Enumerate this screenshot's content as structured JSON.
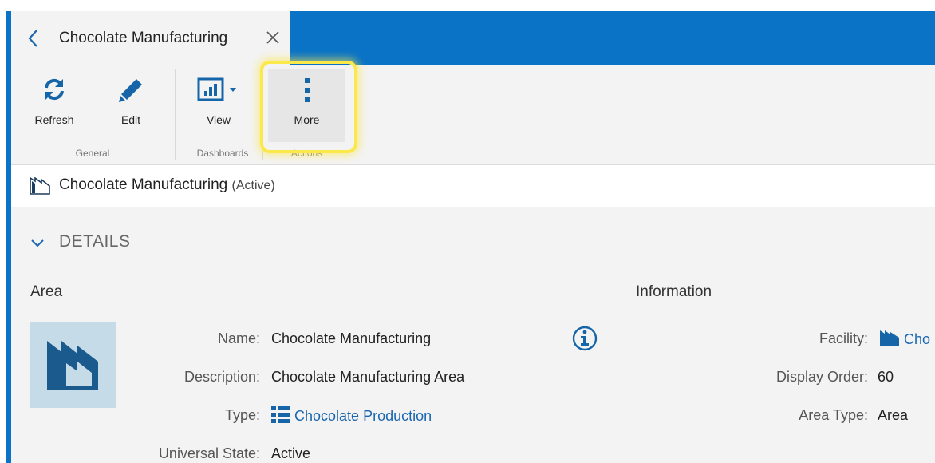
{
  "tab": {
    "title": "Chocolate Manufacturing"
  },
  "ribbon": {
    "general": {
      "label": "General",
      "refresh": "Refresh",
      "edit": "Edit"
    },
    "dashboards": {
      "label": "Dashboards",
      "view": "View"
    },
    "actions": {
      "label": "Actions",
      "more": "More"
    }
  },
  "record": {
    "name": "Chocolate Manufacturing",
    "state": "(Active)"
  },
  "details": {
    "header": "DETAILS"
  },
  "area": {
    "title": "Area",
    "fields": {
      "name_label": "Name:",
      "name_value": "Chocolate Manufacturing",
      "description_label": "Description:",
      "description_value": "Chocolate Manufacturing Area",
      "type_label": "Type:",
      "type_value": "Chocolate Production",
      "state_label": "Universal State:",
      "state_value": "Active"
    }
  },
  "information": {
    "title": "Information",
    "fields": {
      "facility_label": "Facility:",
      "facility_value": "Cho",
      "order_label": "Display Order:",
      "order_value": "60",
      "areatype_label": "Area Type:",
      "areatype_value": "Area"
    }
  },
  "colors": {
    "brand": "#0a73c6",
    "link": "#1a67b0",
    "highlight": "#fbe84a"
  },
  "icons": [
    "chevron-left-icon",
    "close-icon",
    "refresh-icon",
    "edit-icon",
    "chart-icon",
    "more-vertical-icon",
    "factory-icon",
    "chevron-down-icon",
    "info-icon",
    "list-icon"
  ]
}
